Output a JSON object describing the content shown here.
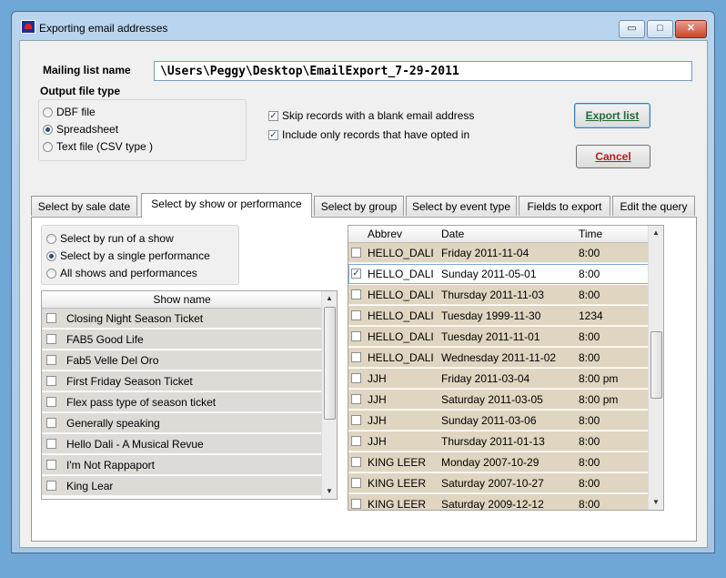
{
  "window": {
    "title": "Exporting email addresses",
    "minimize": "▭",
    "maximize": "□",
    "close": "✕"
  },
  "form": {
    "mailing_list_label": "Mailing list name",
    "mailing_list_value": "\\Users\\Peggy\\Desktop\\EmailExport_7-29-2011",
    "output_type_label": "Output file type",
    "output_options": [
      {
        "label": "DBF file",
        "selected": false
      },
      {
        "label": "Spreadsheet",
        "selected": true
      },
      {
        "label": "Text file (CSV type )",
        "selected": false
      }
    ],
    "skip_blank_label": "Skip records with a blank email address",
    "skip_blank_checked": true,
    "opted_in_label": "Include only records that have opted in",
    "opted_in_checked": true,
    "export_button": "Export list",
    "cancel_button": "Cancel"
  },
  "tabs": [
    "Select by sale date",
    "Select by show or performance",
    "Select by group",
    "Select by event type",
    "Fields to export",
    "Edit the query"
  ],
  "active_tab": 1,
  "show_options": [
    {
      "label": "Select by run of a show",
      "selected": false
    },
    {
      "label": "Select by a single performance",
      "selected": true
    },
    {
      "label": "All shows and performances",
      "selected": false
    }
  ],
  "show_list": {
    "header": "Show name",
    "items": [
      "Closing Night Season Ticket",
      "FAB5 Good Life",
      "Fab5 Velle Del Oro",
      "First Friday Season Ticket",
      "Flex pass type of season ticket",
      "Generally speaking",
      "Hello Dali - A Musical Revue",
      "I'm Not Rappaport",
      "King Lear"
    ]
  },
  "performances": {
    "headers": {
      "abbrev": "Abbrev",
      "date": "Date",
      "time": "Time"
    },
    "rows": [
      {
        "abbrev": "HELLO_DALI",
        "date": "Friday 2011-11-04",
        "time": "8:00",
        "checked": false
      },
      {
        "abbrev": "HELLO_DALI",
        "date": "Sunday 2011-05-01",
        "time": "8:00",
        "checked": true
      },
      {
        "abbrev": "HELLO_DALI",
        "date": "Thursday 2011-11-03",
        "time": "8:00",
        "checked": false
      },
      {
        "abbrev": "HELLO_DALI",
        "date": "Tuesday 1999-11-30",
        "time": "1234",
        "checked": false
      },
      {
        "abbrev": "HELLO_DALI",
        "date": "Tuesday 2011-11-01",
        "time": "8:00",
        "checked": false
      },
      {
        "abbrev": "HELLO_DALI",
        "date": "Wednesday 2011-11-02",
        "time": "8:00",
        "checked": false
      },
      {
        "abbrev": "JJH",
        "date": "Friday 2011-03-04",
        "time": "8:00 pm",
        "checked": false
      },
      {
        "abbrev": "JJH",
        "date": "Saturday 2011-03-05",
        "time": "8:00 pm",
        "checked": false
      },
      {
        "abbrev": "JJH",
        "date": "Sunday 2011-03-06",
        "time": "8:00",
        "checked": false
      },
      {
        "abbrev": "JJH",
        "date": "Thursday 2011-01-13",
        "time": "8:00",
        "checked": false
      },
      {
        "abbrev": "KING LEER",
        "date": "Monday 2007-10-29",
        "time": "8:00",
        "checked": false
      },
      {
        "abbrev": "KING LEER",
        "date": "Saturday 2007-10-27",
        "time": "8:00",
        "checked": false
      },
      {
        "abbrev": "KING LEER",
        "date": "Saturday 2009-12-12",
        "time": "8:00",
        "checked": false
      }
    ]
  }
}
